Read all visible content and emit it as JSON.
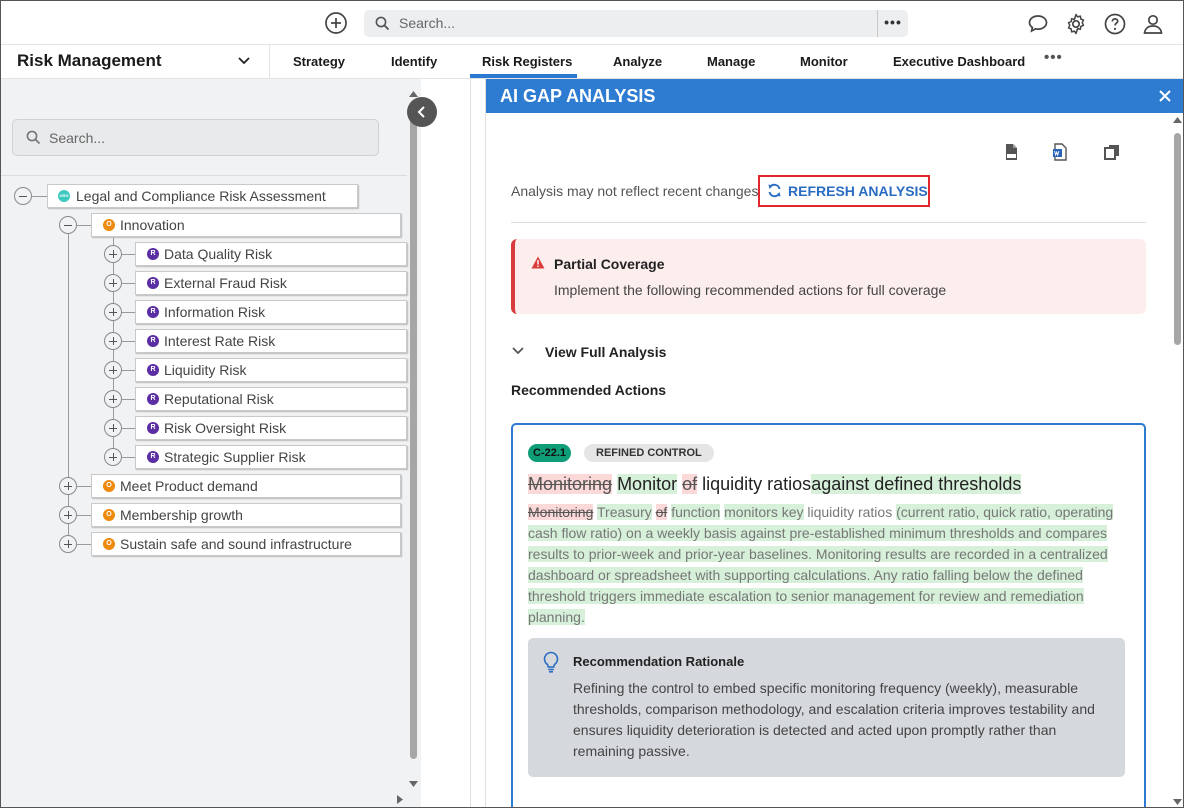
{
  "topbar": {
    "search_placeholder": "Search...",
    "search_more": "•••"
  },
  "nav": {
    "app_name": "Risk Management",
    "tabs": [
      "Strategy",
      "Identify",
      "Risk Registers",
      "Analyze",
      "Manage",
      "Monitor",
      "Executive Dashboard"
    ],
    "active_tab": "Risk Registers",
    "more": "•••"
  },
  "tree": {
    "search_placeholder": "Search...",
    "root": {
      "label": "Legal and Compliance Risk Assessment",
      "badge": "ORG"
    },
    "innovation": {
      "label": "Innovation",
      "badge": "O"
    },
    "risks": [
      {
        "label": "Data Quality Risk",
        "badge": "R"
      },
      {
        "label": "External Fraud Risk",
        "badge": "R"
      },
      {
        "label": "Information Risk",
        "badge": "R"
      },
      {
        "label": "Interest Rate Risk",
        "badge": "R"
      },
      {
        "label": "Liquidity Risk",
        "badge": "R"
      },
      {
        "label": "Reputational Risk",
        "badge": "R"
      },
      {
        "label": "Risk Oversight Risk",
        "badge": "R"
      },
      {
        "label": "Strategic Supplier Risk",
        "badge": "R"
      }
    ],
    "objectives": [
      {
        "label": "Meet Product demand",
        "badge": "O"
      },
      {
        "label": "Membership growth",
        "badge": "O"
      },
      {
        "label": "Sustain safe and sound infrastructure",
        "badge": "O"
      }
    ]
  },
  "panel": {
    "title": "AI GAP ANALYSIS",
    "notice": "Analysis may not reflect recent changes",
    "refresh_label": "REFRESH ANALYSIS",
    "alert_title": "Partial Coverage",
    "alert_desc": "Implement the following recommended actions for full coverage",
    "view_full": "View Full Analysis",
    "recommended_title": "Recommended Actions",
    "card": {
      "id": "C-22.1",
      "type": "REFINED CONTROL",
      "title_del1": "Monitoring",
      "title_ins1": "Monitor",
      "title_del2": "of",
      "title_keep": "liquidity ratios",
      "title_ins2": "against defined thresholds",
      "desc_del1": "Monitoring",
      "desc_ins1": "Treasury",
      "desc_del2": "of",
      "desc_ins2": "function",
      "desc_ins3": "monitors key",
      "desc_keep": "liquidity ratios",
      "desc_ins4": "(current ratio, quick ratio, operating cash flow ratio) on a weekly basis against pre-established minimum thresholds and compares results to prior-week and prior-year baselines. Monitoring results are recorded in a centralized dashboard or spreadsheet with supporting calculations. Any ratio falling below the defined threshold triggers immediate escalation to senior management for review and remediation planning.",
      "rationale_title": "Recommendation Rationale",
      "rationale_text": "Refining the control to embed specific monitoring frequency (weekly), measurable thresholds, comparison methodology, and escalation criteria improves testability and ensures liquidity deterioration is detected and acted upon promptly rather than remaining passive."
    }
  },
  "colors": {
    "accent": "#2d7cd1",
    "alert_red": "#d93c3c",
    "highlight_box": "#e2262d",
    "chip_green": "#0f9d77",
    "insert_bg": "#d6f0da",
    "delete_bg": "#fbd9d9"
  }
}
